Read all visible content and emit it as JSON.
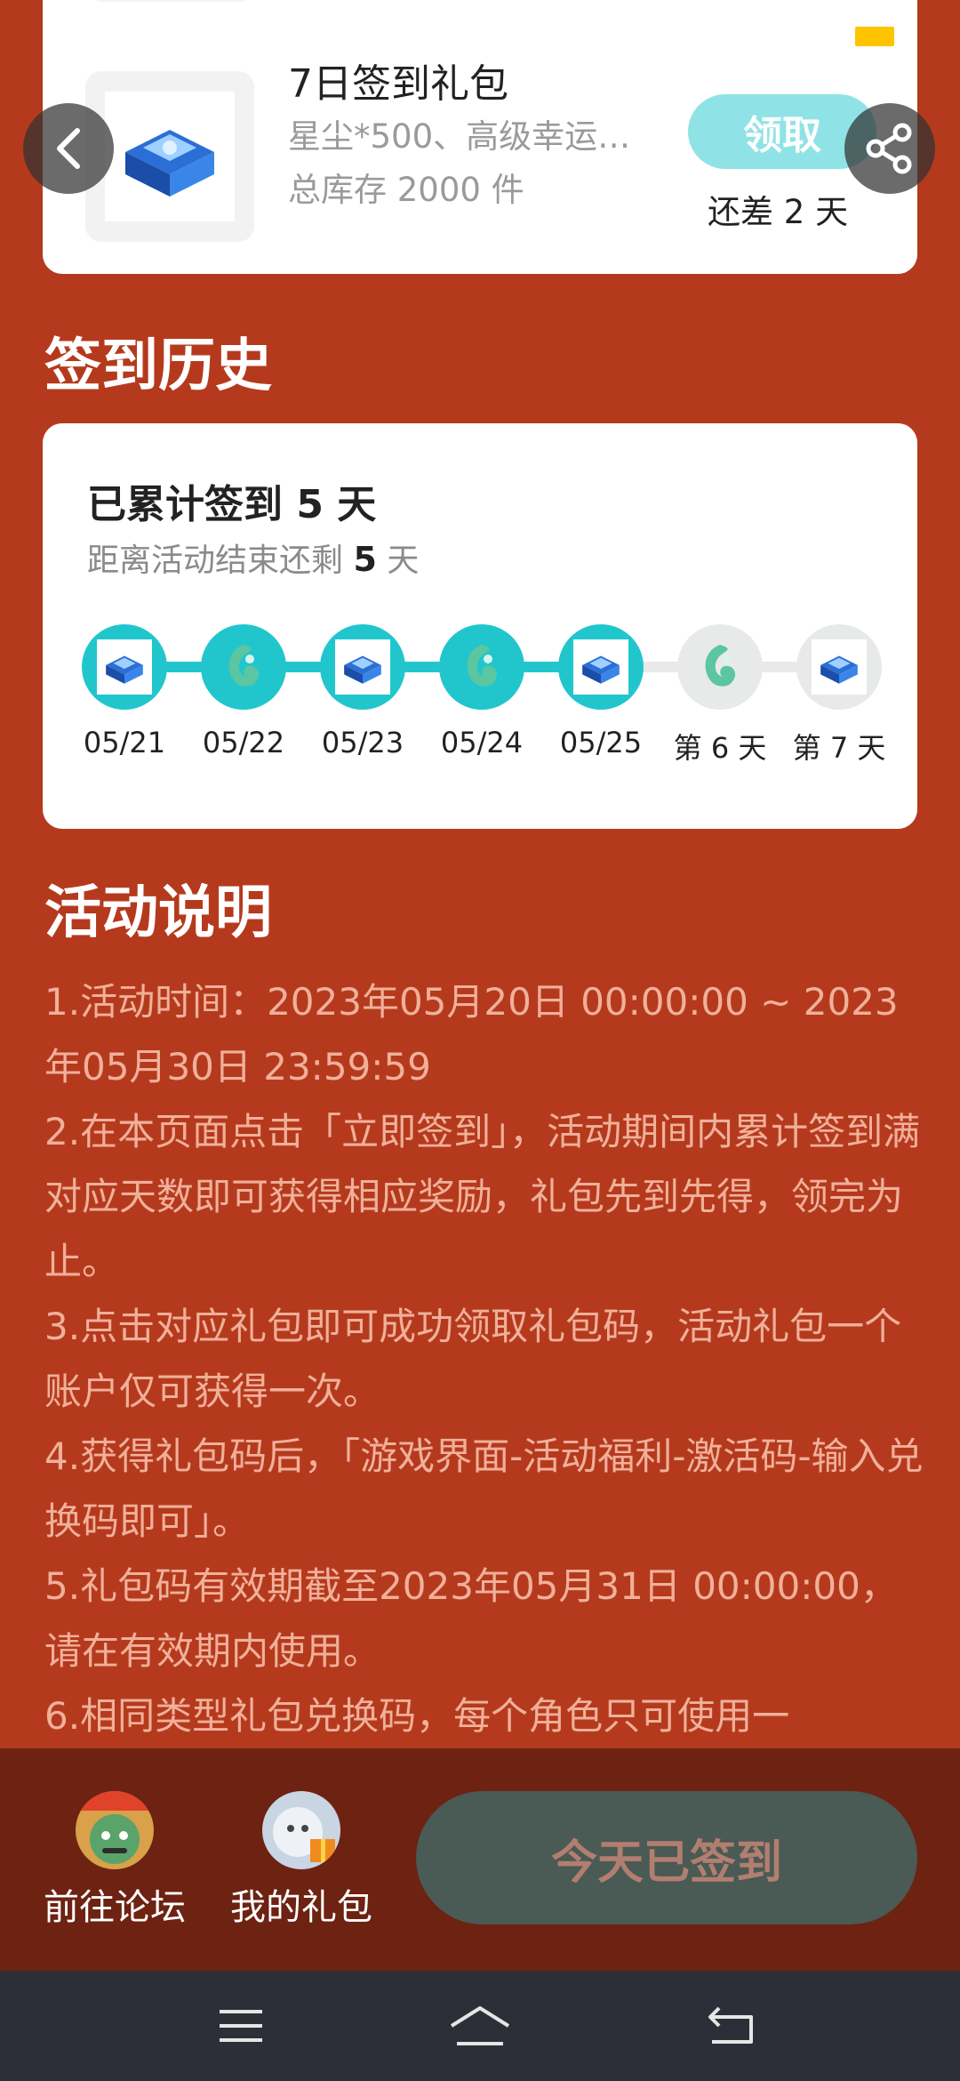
{
  "top_card": {
    "gift_title": "7日签到礼包",
    "gift_desc": "星尘*500、高级幸运…",
    "gift_stock": "总库存 2000 件",
    "claim_label": "领取",
    "remain_label": "还差 2 天"
  },
  "history": {
    "section_title": "签到历史",
    "total_prefix": "已累计签到",
    "total_days": "5",
    "total_suffix": "天",
    "remain_prefix": "距离活动结束还剩",
    "remain_days": "5",
    "remain_suffix": "天",
    "nodes": [
      {
        "label": "05/21",
        "icon": "blue-chest-icon",
        "status": "done"
      },
      {
        "label": "05/22",
        "icon": "jade-pendant-icon",
        "status": "done"
      },
      {
        "label": "05/23",
        "icon": "blue-chest-icon",
        "status": "done"
      },
      {
        "label": "05/24",
        "icon": "jade-pendant-icon",
        "status": "done"
      },
      {
        "label": "05/25",
        "icon": "blue-chest-icon",
        "status": "done"
      },
      {
        "label": "第 6 天",
        "icon": "jade-pendant-icon",
        "status": "todo"
      },
      {
        "label": "第 7 天",
        "icon": "blue-chest-icon",
        "status": "todo"
      }
    ]
  },
  "rules": {
    "section_title": "活动说明",
    "lines": [
      "1.活动时间：2023年05月20日 00:00:00 ~ 2023年05月30日 23:59:59",
      "2.在本页面点击「立即签到」，活动期间内累计签到满对应天数即可获得相应奖励，礼包先到先得，领完为止。",
      "3.点击对应礼包即可成功领取礼包码，活动礼包一个账户仅可获得一次。",
      "4.获得礼包码后，「游戏界面-活动福利-激活码-输入兑换码即可」。",
      "5.礼包码有效期截至2023年05月31日 00:00:00，请在有效期内使用。",
      "6.相同类型礼包兑换码，每个角色只可使用一"
    ]
  },
  "bottom_bar": {
    "forum_label": "前往论坛",
    "my_gifts_label": "我的礼包",
    "signed_label": "今天已签到"
  },
  "colors": {
    "background": "#b53a1d",
    "accent_teal": "#21c6cd",
    "claim_button": "#8fe3e6",
    "bottom_bar": "#6d2212",
    "signed_button": "#4a5a54"
  }
}
